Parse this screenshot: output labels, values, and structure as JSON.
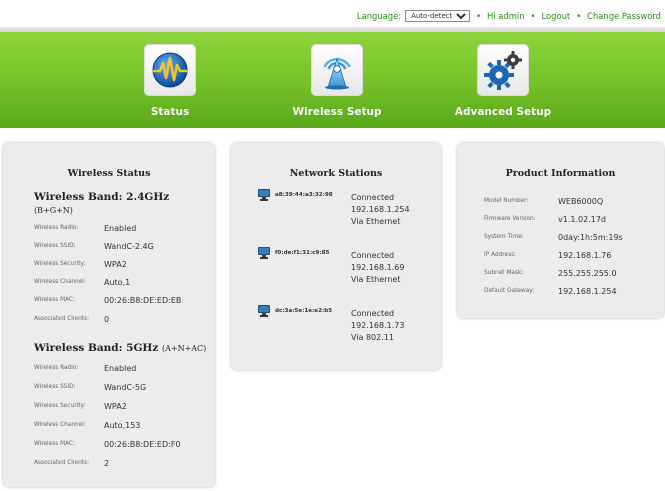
{
  "topbar": {
    "language_label": "Language:",
    "language_value": "Auto-detect",
    "user_link": "Hi admin",
    "logout_link": "Logout",
    "change_password_link": "Change Password",
    "separator": "•"
  },
  "nav": {
    "items": [
      {
        "label": "Status",
        "icon": "status-waveform-icon"
      },
      {
        "label": "Wireless Setup",
        "icon": "wireless-tower-icon"
      },
      {
        "label": "Advanced Setup",
        "icon": "gears-icon"
      }
    ]
  },
  "wireless_status": {
    "title": "Wireless Status",
    "band1": {
      "heading": "Wireless Band: 2.4GHz",
      "sub": "(B+G+N)",
      "rows": [
        {
          "label": "Wireless Radio:",
          "value": "Enabled"
        },
        {
          "label": "Wireless SSID:",
          "value": "WandC-2.4G"
        },
        {
          "label": "Wireless Security:",
          "value": "WPA2"
        },
        {
          "label": "Wireless Channel:",
          "value": "Auto,1"
        },
        {
          "label": "Wireless MAC:",
          "value": "00:26:B8:DE:ED:EB"
        },
        {
          "label": "Associated Clients:",
          "value": "0"
        }
      ]
    },
    "band2": {
      "heading": "Wireless Band: 5GHz",
      "sub": "(A+N+AC)",
      "rows": [
        {
          "label": "Wireless Radio:",
          "value": "Enabled"
        },
        {
          "label": "Wireless SSID:",
          "value": "WandC-5G"
        },
        {
          "label": "Wireless Security:",
          "value": "WPA2"
        },
        {
          "label": "Wireless Channel:",
          "value": "Auto,153"
        },
        {
          "label": "Wireless MAC:",
          "value": "00:26:B8:DE:ED:F0"
        },
        {
          "label": "Associated Clients:",
          "value": "2"
        }
      ]
    }
  },
  "network_stations": {
    "title": "Network Stations",
    "stations": [
      {
        "mac": "a8:39:44:a3:32:98",
        "status": "Connected",
        "ip": "192.168.1.254",
        "via": "Via Ethernet"
      },
      {
        "mac": "f0:de:f1:31:c9:85",
        "status": "Connected",
        "ip": "192.168.1.69",
        "via": "Via Ethernet"
      },
      {
        "mac": "dc:3a:5e:1e:e2:b5",
        "status": "Connected",
        "ip": "192.168.1.73",
        "via": "Via 802.11"
      }
    ]
  },
  "product_info": {
    "title": "Product Information",
    "rows": [
      {
        "label": "Model Number:",
        "value": "WEB6000Q"
      },
      {
        "label": "Firmware Version:",
        "value": "v1.1.02.17d"
      },
      {
        "label": "System Time:",
        "value": "0day:1h:5m:19s"
      },
      {
        "label": "IP Address:",
        "value": "192.168.1.76"
      },
      {
        "label": "Subnet Mask:",
        "value": "255.255.255.0"
      },
      {
        "label": "Default Gateway:",
        "value": "192.168.1.254"
      }
    ]
  },
  "colors": {
    "accent_green": "#79c52b",
    "link_green": "#2d8a18",
    "panel_bg": "#ececec"
  }
}
